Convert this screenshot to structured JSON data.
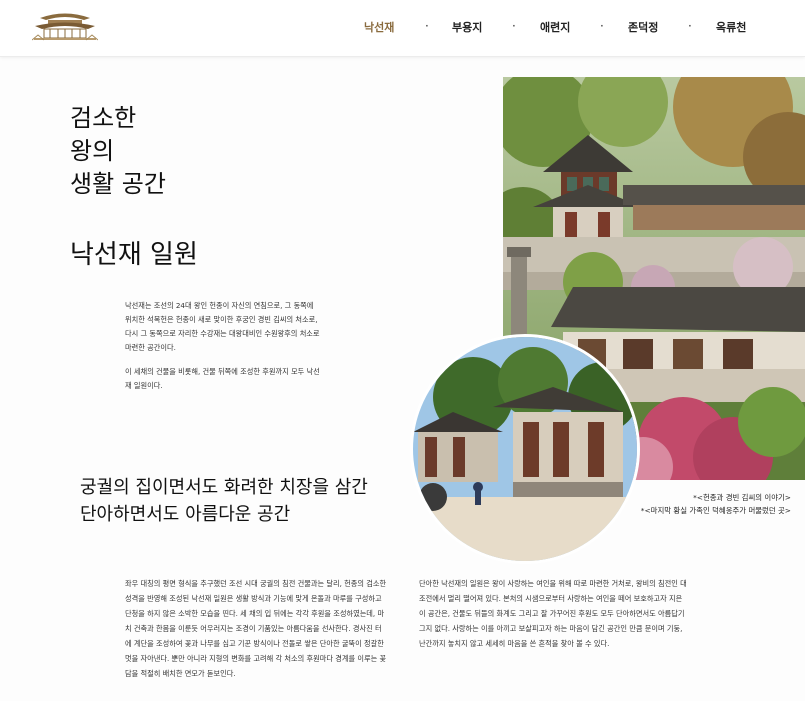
{
  "header": {
    "logo": "palace-logo-icon",
    "nav": [
      {
        "label": "낙선재",
        "active": true
      },
      {
        "label": "부용지",
        "active": false
      },
      {
        "label": "애련지",
        "active": false
      },
      {
        "label": "존덕정",
        "active": false
      },
      {
        "label": "옥류천",
        "active": false
      }
    ],
    "separator": "·",
    "active_color": "#8a6b3e"
  },
  "hero": {
    "title_lines": [
      "검소한",
      "왕의",
      "생활 공간"
    ],
    "place_title": "낙선재 일원"
  },
  "intro": {
    "paragraph1": "낙선재는 조선의 24대 왕인 헌종이 자신의 연침으로, 그 동쪽에 위치한 석복헌은 헌종이 새로 맞이한 후궁인 경빈 김씨의 처소로, 다시 그 동쪽으로 자리한 수강재는 대왕대비인 수원왕후의 처소로 마련한 공간이다.",
    "paragraph2": "이 세채의 건물을 비롯해, 건물 뒤쪽에 조성한 후원까지 모두 낙선재 일원이다."
  },
  "subheading": {
    "line1": "궁궐의 집이면서도 화려한 치장을 삼간",
    "line2": "단아하면서도 아름다운 공간"
  },
  "captions": {
    "caption1": "*<헌종과 경빈 김씨의 이야기>",
    "caption2": "*<마지막 황실 가족인 덕혜옹주가 머물렀던 곳>"
  },
  "body": {
    "col1": "좌우 대칭의 평면 형식을 추구했던 조선 시대 궁궐의 침전 건물과는 달리, 헌종의 검소한 성격을 반영해 조성된 낙선재 일원은 생활 방식과 기능에 맞게 온돌과 마루를 구성하고 단청을 하지 않은 소박한 모습을 띤다. 세 채의 입 뒤에는 각각 후원을 조성하였는데, 마치 건축과 한몸을 이룬듯 어우러지는 조경이 기품있는 아름다움을 선사한다. 경사진 터에 계단을 조성하여 꽃과 나무를 심고 기꾼 방식이나 전돌로 쌓은 단아한 굴뚝이 정갈한 멋을 자아낸다. 뿐만 아니라 지형의 변화를 고려해 각 처소의 후원마다 경계를 이루는 꽃담을 적절히 배치한 면모가 돋보인다.",
    "col2": "단아한 낙선재의 일원은 왕이 사랑하는 여인을 위해 따로 마련한 거처로, 왕비의 침전인 대조전에서 멀리 떨어져 있다. 본처의 시샘으로부터 사랑하는 여인을 떼어 보호하고자 지은 이 공간은, 건물도 뒤뜰의 화계도 그리고 잘 가꾸어진 후원도 모두 단아하면서도 아름답기 그지 없다. 사랑하는 이를 아끼고 보살피고자 하는 마음이 담긴 공간인 만큼 문이며 기둥, 난간까지 놓치지 않고 세세히 마음을 쓴 흔적을 찾아 볼 수 있다."
  }
}
